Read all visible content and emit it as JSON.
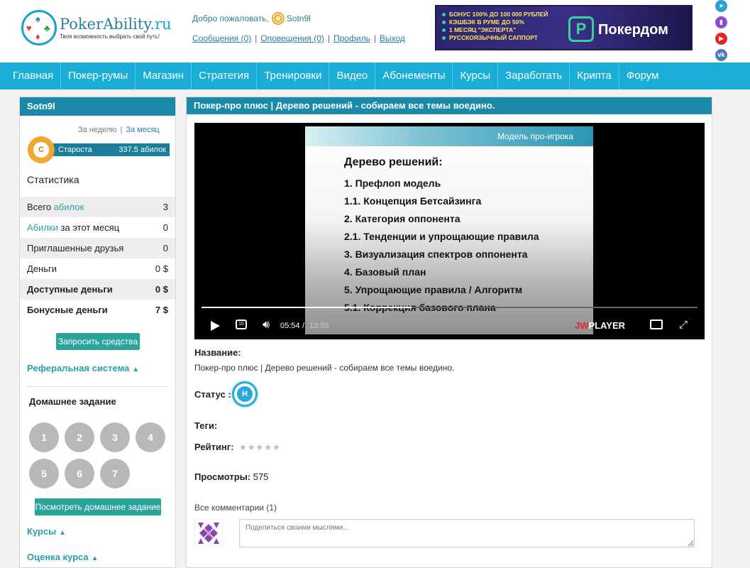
{
  "header": {
    "logo_name": "PokerAbility",
    "logo_domain": ".ru",
    "logo_tagline": "Твоя возможность выбрать свой путь!",
    "welcome": "Добро пожаловать,",
    "username": "Sotn9l",
    "links": [
      "Сообщения (0)",
      "Оповещения (0)",
      "Профиль",
      "Выход"
    ]
  },
  "banner": {
    "bullets": [
      "БОНУС 100% ДО 100 000 РУБЛЕЙ",
      "КЭШБЭК В РУМЕ ДО 50%",
      "1 МЕСЯЦ \"ЭКСПЕРТА\"",
      "РУССКОЯЗЫЧНЫЙ САППОРТ"
    ],
    "brand": "Покердом"
  },
  "nav": [
    "Главная",
    "Покер-румы",
    "Магазин",
    "Стратегия",
    "Тренировки",
    "Видео",
    "Абонементы",
    "Курсы",
    "Заработать",
    "Крипта",
    "Форум"
  ],
  "sidebar": {
    "username": "Sotn9l",
    "period_week": "За неделю",
    "period_month": "За месяц",
    "rank_badge": "С",
    "rank": "Староста",
    "rank_points": "337.5 абилок",
    "stats_title": "Статистика",
    "stats": [
      {
        "pre": "Всего ",
        "hl": "абилок",
        "post": "",
        "value": "3"
      },
      {
        "pre": "",
        "hl": "Абилки",
        "post": " за этот месяц",
        "value": "0"
      },
      {
        "pre": "Приглашенные друзья",
        "hl": "",
        "post": "",
        "value": "0"
      },
      {
        "pre": "Деньги",
        "hl": "",
        "post": "",
        "value": "0 $"
      },
      {
        "pre": "Доступные деньги",
        "hl": "",
        "post": "",
        "value": "0 $",
        "bold": true
      },
      {
        "pre": "Бонусные деньги",
        "hl": "",
        "post": "",
        "value": "7 $",
        "bold": true
      }
    ],
    "request_button": "Запросить средства",
    "referral_title": "Реферальная система",
    "homework_title": "Домашнее задание",
    "homework_items": [
      "1",
      "2",
      "3",
      "4",
      "5",
      "6",
      "7"
    ],
    "homework_button": "Посмотреть домашнее задание",
    "courses_title": "Курсы",
    "rate_title": "Оценка курса"
  },
  "main": {
    "title": "Покер-про плюс | Дерево решений - собираем все темы воедино.",
    "slide": {
      "header": "Модель про-игрока",
      "title": "Дерево решений:",
      "items": [
        "1. Префлоп модель",
        "1.1. Концепция Бетсайзинга",
        "2. Категория оппонента",
        "2.1. Тенденции и упрощающие правила",
        "3. Визуализация спектров оппонента",
        "4. Базовый план",
        "5. Упрощающие правила / Алгоритм",
        "5.1. Коррекция базового плана"
      ]
    },
    "player": {
      "current_time": "05:54",
      "separator": "/",
      "duration": "13:55",
      "progress": 0.424,
      "brand_jw": "JW",
      "brand_player": "PLAYER",
      "rewind_label": "10"
    },
    "name_label": "Название:",
    "name_value": "Покер-про плюс | Дерево решений - собираем все темы воедино.",
    "status_label": "Статус :",
    "status_badge": "Н",
    "tags_label": "Теги:",
    "rating_label": "Рейтинг:",
    "rating_stars": "★★★★★",
    "views_label": "Просмотры:",
    "views_value": "575",
    "comments_title": "Все комментарии (1)",
    "comment_placeholder": "Поделиться своими мыслями..."
  },
  "colors": {
    "accent": "#1aaed6",
    "header_bar": "#1a8aa8",
    "teal_button": "#2aa39a"
  }
}
